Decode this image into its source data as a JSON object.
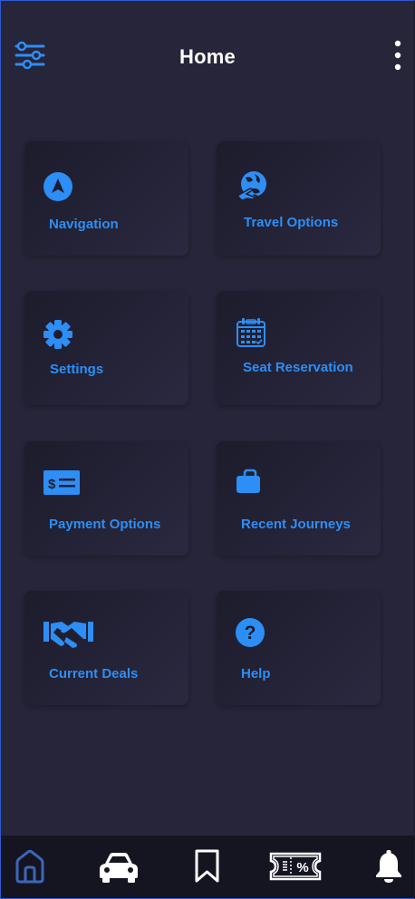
{
  "header": {
    "title": "Home"
  },
  "menu": [
    {
      "label": "Navigation",
      "icon": "navigation-arrow-icon"
    },
    {
      "label": "Travel Options",
      "icon": "globe-plane-icon"
    },
    {
      "label": "Settings",
      "icon": "gear-icon"
    },
    {
      "label": "Seat Reservation",
      "icon": "calendar-icon"
    },
    {
      "label": "Payment Options",
      "icon": "payment-check-icon"
    },
    {
      "label": "Recent Journeys",
      "icon": "briefcase-icon"
    },
    {
      "label": "Current Deals",
      "icon": "handshake-icon"
    },
    {
      "label": "Help",
      "icon": "question-circle-icon"
    }
  ],
  "bottom_nav": [
    {
      "icon": "home-icon",
      "active": true
    },
    {
      "icon": "car-icon",
      "active": false
    },
    {
      "icon": "bookmark-icon",
      "active": false
    },
    {
      "icon": "ticket-discount-icon",
      "active": false
    },
    {
      "icon": "bell-icon",
      "active": false
    }
  ],
  "colors": {
    "background": "#262539",
    "accent": "#2d8ef5",
    "card": "#232236",
    "navbar": "#151522",
    "nav_active": "#3a68b8",
    "nav_icon": "#ffffff"
  }
}
